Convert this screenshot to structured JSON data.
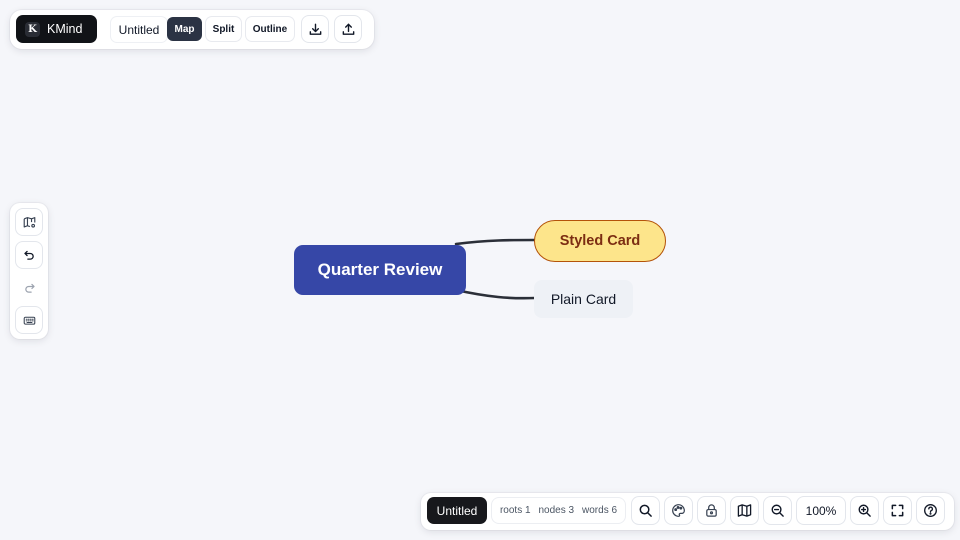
{
  "toolbar": {
    "brand_mark": "K",
    "brand_name": "KMind",
    "doc_title": "Untitled",
    "views": [
      {
        "label": "Map",
        "active": true
      },
      {
        "label": "Split",
        "active": false
      },
      {
        "label": "Outline",
        "active": false
      }
    ],
    "actions": [
      {
        "icon": "download-icon"
      },
      {
        "icon": "upload-icon"
      }
    ]
  },
  "left_toolbar": {
    "items": [
      {
        "icon": "map-settings-icon"
      },
      {
        "icon": "undo-icon"
      },
      {
        "icon": "redo-icon",
        "disabled": true
      },
      {
        "icon": "keyboard-icon"
      }
    ]
  },
  "mindmap": {
    "root": {
      "label": "Quarter Review",
      "color": "#3647a7"
    },
    "children": [
      {
        "label": "Styled Card",
        "fill": "#fde58b",
        "border": "#b45309",
        "text_color": "#7c2d12"
      },
      {
        "label": "Plain Card",
        "fill": "#eef1f6"
      }
    ],
    "edge_color": "#2b2f38"
  },
  "status_bar": {
    "title": "Untitled",
    "stats": {
      "roots": "roots 1",
      "nodes": "nodes 3",
      "words": "words 6"
    },
    "zoom": "100%",
    "icons": [
      "search-icon",
      "theme-icon",
      "lock-icon",
      "minimap-icon",
      "zoom-out-icon",
      "zoom-in-icon",
      "fullscreen-icon",
      "help-icon"
    ]
  },
  "colors": {
    "background": "#f5f6fa",
    "accent": "#3647a7",
    "active_tab": "#2b3344"
  }
}
